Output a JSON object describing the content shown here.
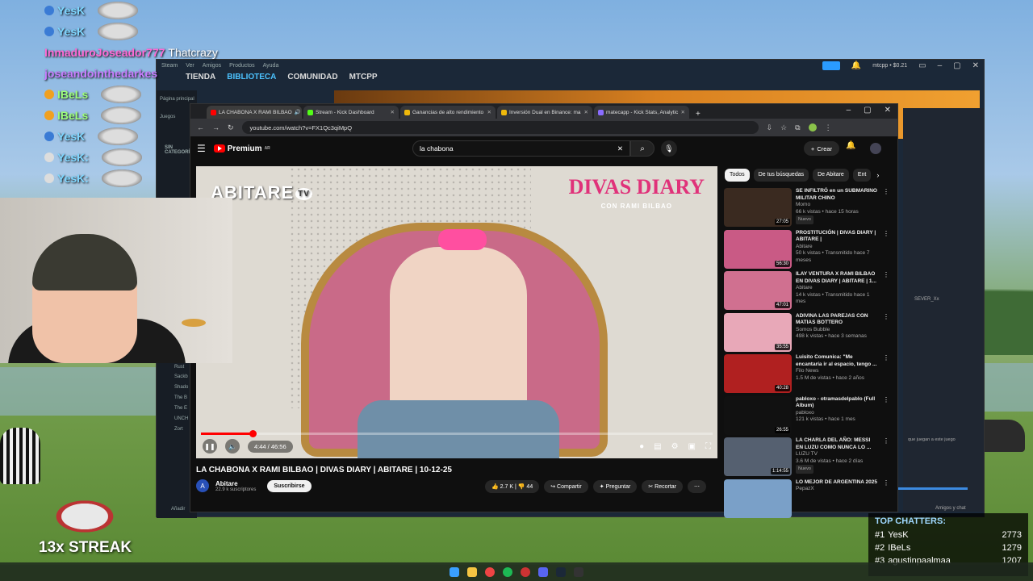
{
  "chat": [
    {
      "user": "YesK",
      "cls": "user-blue",
      "badge": "b"
    },
    {
      "user": "YesK",
      "cls": "user-blue",
      "badge": "b"
    },
    {
      "user": "InmaduroJoseador777",
      "cls": "user-pink",
      "msg": " Thatcrazy"
    },
    {
      "user": "joseandointhedarkes",
      "cls": "user-purple",
      "msg": ""
    },
    {
      "user": "IBeLs",
      "cls": "user-green",
      "badge": "b3"
    },
    {
      "user": "IBeLs",
      "cls": "user-green",
      "badge": "b3"
    },
    {
      "user": "YesK",
      "cls": "user-blue",
      "badge": "b"
    },
    {
      "user": "YesK:",
      "cls": "user-blue",
      "badge": "b2"
    },
    {
      "user": "YesK:",
      "cls": "user-blue",
      "badge": "b2"
    }
  ],
  "steam": {
    "menu": [
      "Steam",
      "Ver",
      "Amigos",
      "Productos",
      "Ayuda"
    ],
    "nav": [
      "TIENDA",
      "BIBLIOTECA",
      "COMUNIDAD",
      "MTCPP"
    ],
    "user": "mtcpp • $0.21",
    "side": [
      "Página principal",
      "Juegos",
      "SIN CATEGORÍA",
      "Rust",
      "Sackb",
      "Shado",
      "The B",
      "The E",
      "UNCH",
      "Zort",
      "Añadir"
    ],
    "right_text": "SEVER_Xx",
    "friends": "Amigos y chat",
    "hint": "que juegan a este juego"
  },
  "browser": {
    "tabs": [
      {
        "label": "LA CHABONA X RAMI BILBAO",
        "color": "#f00",
        "active": true
      },
      {
        "label": "Stream - Kick Dashboard",
        "color": "#53fc18"
      },
      {
        "label": "Ganancias de alto rendimiento",
        "color": "#f0b90b"
      },
      {
        "label": "Inversión Dual en Binance: ma",
        "color": "#f0b90b"
      },
      {
        "label": "matecapp - Kick Stats, Analytic",
        "color": "#8a6cff"
      }
    ],
    "url": "youtube.com/watch?v=FX1Qc3qiMpQ"
  },
  "youtube": {
    "logo": "Premium",
    "logo_sup": "AR",
    "search": "la chabona",
    "create": "Crear",
    "player": {
      "brand_left": "ABITARE",
      "brand_left_badge": "TV",
      "brand_right": "DIVAS DIARY",
      "brand_right_sub": "CON RAMI BILBAO",
      "time": "4:44 / 46:56",
      "progress": 0.101
    },
    "title": "LA CHABONA X RAMI BILBAO | DIVAS DIARY | ABITARE | 10-12-25",
    "channel": {
      "name": "Abitare",
      "subs": "22.9 k suscriptores",
      "subscribe": "Suscribirse"
    },
    "actions": {
      "likes": "2.7 K",
      "dislikes": "44",
      "share": "Compartir",
      "ask": "Preguntar",
      "clip": "Recortar"
    },
    "chips": [
      "Todos",
      "De tus búsquedas",
      "De Abitare",
      "Ent"
    ],
    "recs": [
      {
        "title": "SE INFILTRÓ en un SUBMARINO MILITAR CHINO",
        "channel": "Momo",
        "meta": "66 k vistas • hace 15 horas",
        "dur": "27:05",
        "badge": "Nuevo",
        "color": "#3a2a20"
      },
      {
        "title": "PROSTITUCIÓN | DIVAS DIARY | ABITARE |",
        "channel": "Abitare",
        "meta": "50 k vistas • Transmitido hace 7 meses",
        "dur": "56:30",
        "color": "#c95a85"
      },
      {
        "title": "ILAY VENTURA X RAMI BILBAO EN DIVAS DIARY | ABITARE | 1...",
        "channel": "Abitare",
        "meta": "14 k vistas • Transmitido hace 1 mes",
        "dur": "47:01",
        "color": "#d07090"
      },
      {
        "title": "ADIVINA LAS PAREJAS CON MATIAS BOTTERO",
        "channel": "Somos Bubble",
        "meta": "498 k vistas • hace 3 semanas",
        "dur": "35:55",
        "color": "#e8a8b8"
      },
      {
        "title": "Luisito Comunica: \"Me encantaría ir al espacio, tengo ...",
        "channel": "Filo News",
        "meta": "1.5 M de vistas • hace 2 años",
        "dur": "40:28",
        "color": "#b02020"
      },
      {
        "title": "pabloxo - otramasdelpablo (Full Album)",
        "channel": "pabloxo",
        "meta": "121 k vistas • hace 1 mes",
        "dur": "26:55",
        "color": "#111"
      },
      {
        "title": "LA CHARLA DEL AÑO: MESSI EN LUZU COMO NUNCA LO ...",
        "channel": "LUZU TV",
        "meta": "3.6 M de vistas • hace 2 días",
        "dur": "1:14:55",
        "badge": "Nuevo",
        "color": "#556070"
      },
      {
        "title": "LO MEJOR DE ARGENTINA 2025",
        "channel": "PepazX",
        "meta": "",
        "dur": "",
        "color": "#7aa0c8"
      }
    ]
  },
  "streak": "13x STREAK",
  "top_chatters": {
    "title": "TOP CHATTERS:",
    "rows": [
      {
        "rank": "#1",
        "name": "YesK",
        "value": "2773"
      },
      {
        "rank": "#2",
        "name": "IBeLs",
        "value": "1279"
      },
      {
        "rank": "#3",
        "name": "agustinpaalmaa",
        "value": "1207"
      }
    ]
  },
  "colors": {
    "youtube_red": "#ff0000",
    "steam_blue": "#4cc3ff"
  }
}
